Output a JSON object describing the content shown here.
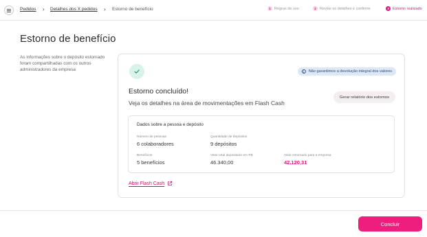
{
  "breadcrumb": {
    "items": [
      "Pedidos",
      "Detalhes dos X pedidos",
      "Estorno de benefício"
    ]
  },
  "stepper": {
    "steps": [
      {
        "number": "1",
        "label": "Regras de uso"
      },
      {
        "number": "2",
        "label": "Revise os detalhes e confirme"
      },
      {
        "number": "3",
        "label": "Estorno realizado"
      }
    ],
    "active_step": 3
  },
  "page": {
    "title": "Estorno de benefício",
    "description": "As informações sobre o depósito estornado foram compartilhadas com os outros administradores da empresa"
  },
  "card": {
    "warning": "Não garantimos a devolução integral dos valores",
    "title": "Estorno concluído!",
    "subtitle": "Veja os detalhes na área de movimentações em Flash Cash",
    "report_button": "Gerar relatório dos estornos",
    "details": {
      "title": "Dados sobre a pessoa e depósito",
      "fields": {
        "people_label": "Número de pessoas",
        "people_value": "6 colaboradores",
        "deposits_label": "Quantidade de depósitos",
        "deposits_value": "9 depósitos",
        "benefits_label": "Benefícios",
        "benefits_value": "5 benefícios",
        "total_label": "Valor total depositado em R$",
        "total_value": "46.340,00",
        "refund_label": "Valor estornado para a empresa",
        "refund_value": "42.120,31"
      }
    },
    "link": "Abrir Flash Cash"
  },
  "footer": {
    "conclude_button": "Concluir"
  },
  "colors": {
    "accent": "#ee1e7e",
    "success_bg": "#d9f2ea",
    "info_bg": "#dde8f6"
  },
  "icons": [
    "menu-icon",
    "chevron-right-icon",
    "check-icon",
    "info-icon",
    "external-link-icon"
  ]
}
